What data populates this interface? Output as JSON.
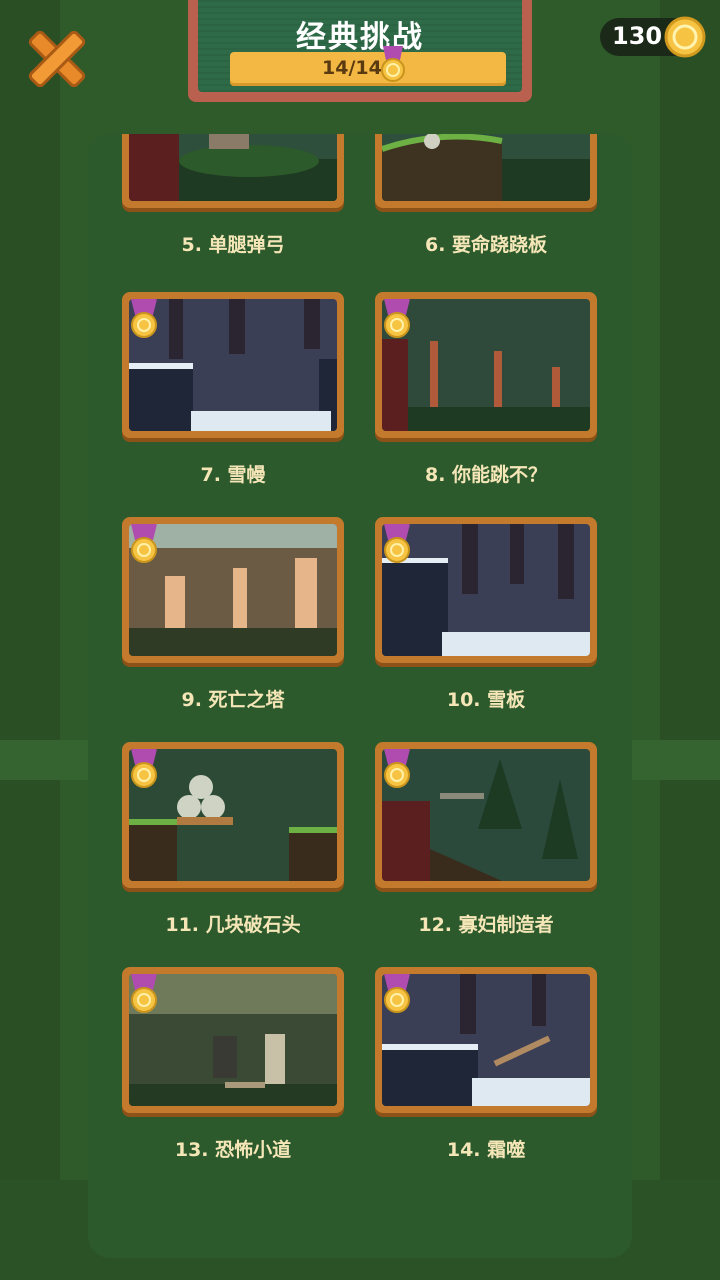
{
  "header": {
    "title": "经典挑战",
    "progress": "14/14"
  },
  "coins": {
    "count": "130"
  },
  "levels": [
    {
      "label": "5. 单腿弹弓",
      "theme": "forest"
    },
    {
      "label": "6. 要命跷跷板",
      "theme": "forest"
    },
    {
      "label": "7. 雪幔",
      "theme": "snow"
    },
    {
      "label": "8. 你能跳不？",
      "theme": "forest"
    },
    {
      "label": "9. 死亡之塔",
      "theme": "desert"
    },
    {
      "label": "10. 雪板",
      "theme": "snow"
    },
    {
      "label": "11. 几块破石头",
      "theme": "forest"
    },
    {
      "label": "12. 寡妇制造者",
      "theme": "forest"
    },
    {
      "label": "13. 恐怖小道",
      "theme": "jungle"
    },
    {
      "label": "14. 霜噬",
      "theme": "snow"
    }
  ],
  "colors": {
    "gold": "#f2b843",
    "frame": "#c47a2c",
    "panel": "#2c5a2c",
    "medal_ribbon": "#b04bb0"
  }
}
